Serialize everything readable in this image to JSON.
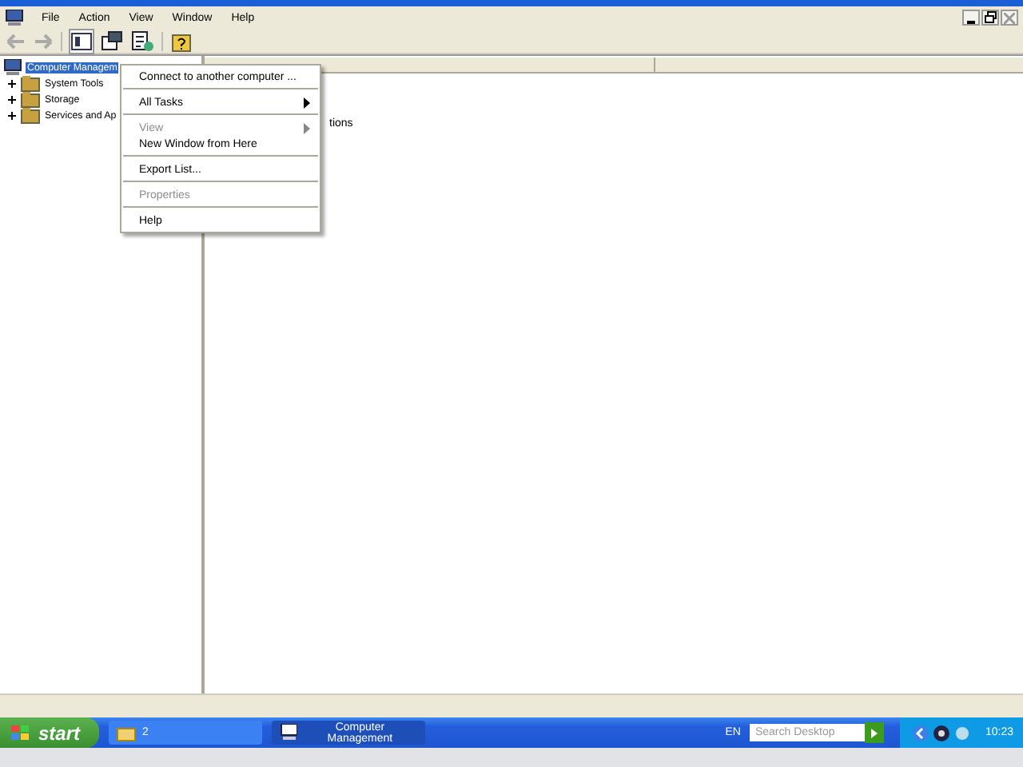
{
  "menu_bar": [
    {
      "label": "File"
    },
    {
      "label": "Action"
    },
    {
      "label": "View"
    },
    {
      "label": "Window"
    },
    {
      "label": "Help"
    }
  ],
  "tree": [
    {
      "label": "Computer Managem",
      "selected": true,
      "children": [
        {
          "label": "System Tools",
          "expanded": false
        },
        {
          "label": "Storage",
          "expanded": false
        },
        {
          "label": "Services and Ap",
          "expanded": false
        }
      ]
    }
  ],
  "list": {
    "rows": [
      "tions"
    ]
  },
  "context_menu": [
    {
      "kind": "item",
      "label": "Connect to another computer ...",
      "disabled": false,
      "submenu": false
    },
    {
      "kind": "separator"
    },
    {
      "kind": "item",
      "label": "All Tasks",
      "disabled": false,
      "submenu": true
    },
    {
      "kind": "separator"
    },
    {
      "kind": "item",
      "label": "View",
      "disabled": true,
      "submenu": true
    },
    {
      "kind": "item",
      "label": "New Window from Here",
      "disabled": false,
      "submenu": false
    },
    {
      "kind": "separator"
    },
    {
      "kind": "item",
      "label": "Export List...",
      "disabled": false,
      "submenu": false
    },
    {
      "kind": "separator"
    },
    {
      "kind": "item",
      "label": "Properties",
      "disabled": true,
      "submenu": false
    },
    {
      "kind": "separator"
    },
    {
      "kind": "item",
      "label": "Help",
      "disabled": false,
      "submenu": false
    }
  ],
  "taskbar": {
    "start": "start",
    "tasks": [
      {
        "label": "2",
        "selected": false
      },
      {
        "label": "Computer Management",
        "selected": true
      }
    ],
    "language": "EN",
    "search": {
      "placeholder": "Search Desktop"
    },
    "clock": "10:23"
  }
}
